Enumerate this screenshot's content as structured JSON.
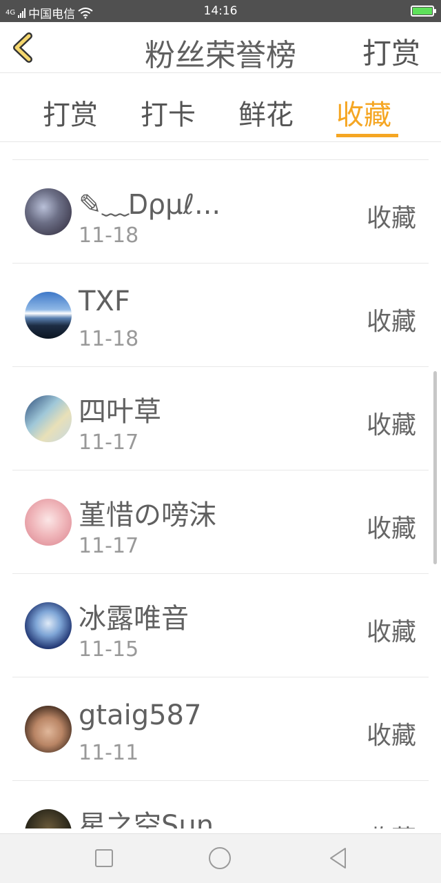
{
  "status_bar": {
    "network": "4G",
    "carrier": "中国电信",
    "time": "14:16",
    "battery_level": 1.0,
    "battery_color": "#5ee15a"
  },
  "header": {
    "back_icon": "chevron-left-icon",
    "title": "粉丝荣誉榜",
    "action": "打赏"
  },
  "tabs": [
    {
      "label": "打赏",
      "active": false
    },
    {
      "label": "打卡",
      "active": false
    },
    {
      "label": "鲜花",
      "active": false
    },
    {
      "label": "收藏",
      "active": true
    }
  ],
  "accent_color": "#f5a623",
  "list": [
    {
      "name": "✎﹏Ꭰρμℓ...",
      "date": "11-18",
      "action": "收藏"
    },
    {
      "name": "TXF",
      "date": "11-18",
      "action": "收藏"
    },
    {
      "name": "四叶草",
      "date": "11-17",
      "action": "收藏"
    },
    {
      "name": "堇惜の嗙沫",
      "date": "11-17",
      "action": "收藏"
    },
    {
      "name": "冰露唯音",
      "date": "11-15",
      "action": "收藏"
    },
    {
      "name": "gtaig587",
      "date": "11-11",
      "action": "收藏"
    },
    {
      "name": "星之空Sun...",
      "date": "",
      "action": "收藏"
    }
  ],
  "nav_bar": {
    "icons": [
      "square-icon",
      "circle-icon",
      "triangle-back-icon"
    ]
  }
}
